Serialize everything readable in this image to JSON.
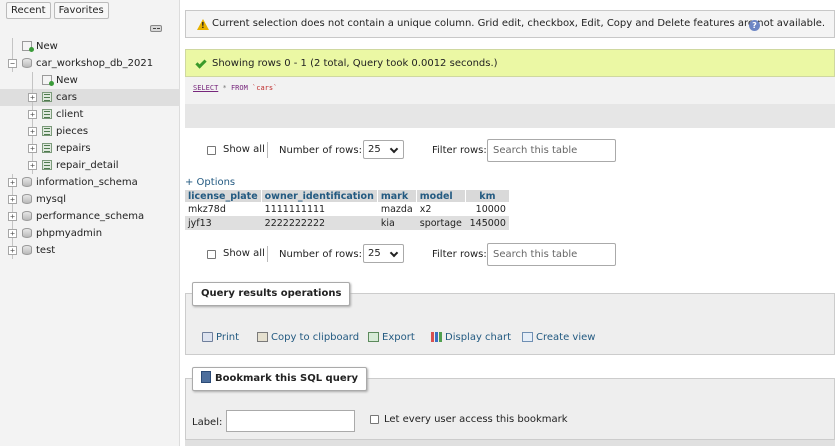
{
  "nav": {
    "tabs": [
      "Recent",
      "Favorites"
    ],
    "tree": [
      {
        "label": "New",
        "kind": "new"
      },
      {
        "label": "car_workshop_db_2021",
        "kind": "db"
      },
      {
        "label": "New",
        "kind": "new"
      },
      {
        "label": "cars",
        "kind": "table",
        "selected": true
      },
      {
        "label": "client",
        "kind": "table"
      },
      {
        "label": "pieces",
        "kind": "table"
      },
      {
        "label": "repairs",
        "kind": "table"
      },
      {
        "label": "repair_detail",
        "kind": "table"
      },
      {
        "label": "information_schema",
        "kind": "db"
      },
      {
        "label": "mysql",
        "kind": "db"
      },
      {
        "label": "performance_schema",
        "kind": "db"
      },
      {
        "label": "phpmyadmin",
        "kind": "db"
      },
      {
        "label": "test",
        "kind": "db"
      }
    ]
  },
  "messages": {
    "warning": "Current selection does not contain a unique column. Grid edit, checkbox, Edit, Copy and Delete features are not available.",
    "success": "Showing rows 0 - 1 (2 total, Query took 0.0012 seconds.)"
  },
  "sql": {
    "select": "SELECT",
    "star": "*",
    "from": "FROM",
    "table": "`cars`"
  },
  "navigation": {
    "show_all": "Show all",
    "rows_label": "Number of rows:",
    "rows_value": "25",
    "filter_label": "Filter rows:",
    "filter_placeholder": "Search this table"
  },
  "options_link": "+ Options",
  "table": {
    "columns": [
      "license_plate",
      "owner_identification",
      "mark",
      "model",
      "km"
    ],
    "rows": [
      [
        "mkz78d",
        "1111111111",
        "mazda",
        "x2",
        "10000"
      ],
      [
        "jyf13",
        "2222222222",
        "kia",
        "sportage",
        "145000"
      ]
    ]
  },
  "query_ops": {
    "legend": "Query results operations",
    "items": [
      "Print",
      "Copy to clipboard",
      "Export",
      "Display chart",
      "Create view"
    ]
  },
  "bookmark": {
    "legend": "Bookmark this SQL query",
    "label": "Label:",
    "checkbox_label": "Let every user access this bookmark"
  }
}
